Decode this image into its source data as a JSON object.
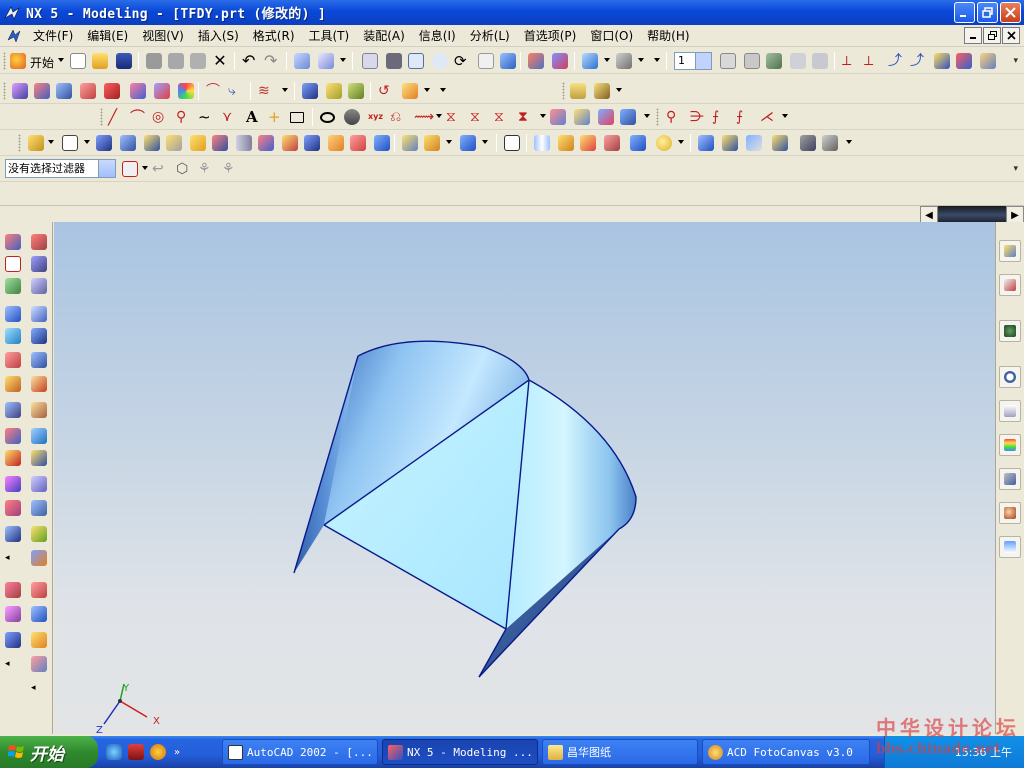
{
  "window": {
    "title": "NX 5 - Modeling - [TFDY.prt  (修改的) ]"
  },
  "menu": {
    "items": [
      "文件(F)",
      "编辑(E)",
      "视图(V)",
      "插入(S)",
      "格式(R)",
      "工具(T)",
      "装配(A)",
      "信息(I)",
      "分析(L)",
      "首选项(P)",
      "窗口(O)",
      "帮助(H)"
    ]
  },
  "toolbar": {
    "start_label": "开始",
    "layer_value": "1",
    "selection_filter": "没有选择过滤器"
  },
  "viewport": {
    "axis_x": "X",
    "axis_y": "Y",
    "axis_z": "Z"
  },
  "taskbar": {
    "start_label": "开始",
    "tasks": [
      {
        "label": "AutoCAD 2002 - [...",
        "active": false,
        "icon": "autocad-icon"
      },
      {
        "label": "NX 5 - Modeling ...",
        "active": true,
        "icon": "nx-icon"
      },
      {
        "label": "昌华图纸",
        "active": false,
        "icon": "folder-icon"
      },
      {
        "label": "ACD FotoCanvas v3.0",
        "active": false,
        "icon": "fotocanvas-icon"
      }
    ],
    "clock": "15:36 上午"
  },
  "watermark": {
    "line1": "中华设计论坛",
    "line2": "bbs.chinade.net"
  },
  "colors": {
    "title_blue": "#0a48d8",
    "surface_light": "#bfe9ff",
    "surface_dark": "#3f78c4",
    "edge": "#0a1a8a"
  }
}
